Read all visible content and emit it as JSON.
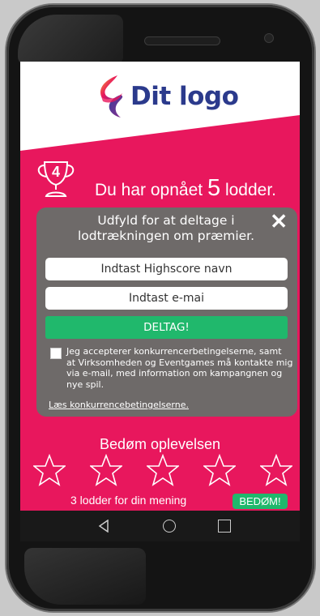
{
  "brand": {
    "logo_text": "Dit logo"
  },
  "achievement": {
    "trophy_number": "4",
    "prefix": "Du har opnået",
    "count": "5",
    "suffix": "lodder."
  },
  "modal": {
    "title": "Udfyld for at deltage i lodtrækningen om præmier.",
    "close_label": "✕",
    "highscore_placeholder": "Indtast Highscore navn",
    "email_placeholder": "Indtast e-mai",
    "submit_label": "DELTAG!",
    "terms_text": "Jeg accepterer konkurrencerbetingelserne, samt at Virksomheden og Eventgames må kontakte mig via e-mail, med information om kampangnen og nye spil.",
    "terms_link": "Læs konkurrencebetingelserne."
  },
  "rating": {
    "title": "Bedøm oplevelsen",
    "stars": 5,
    "reward_text": "3 lodder for din mening",
    "rate_button": "BEDØM!"
  },
  "colors": {
    "primary": "#e8175d",
    "accent": "#20b86c",
    "modal_bg": "#6e6a69",
    "logo_text": "#2b3a8c"
  },
  "navigation": {
    "icons": [
      "back-icon",
      "home-icon",
      "recent-apps-icon"
    ]
  }
}
